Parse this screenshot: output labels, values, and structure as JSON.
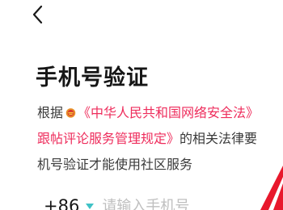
{
  "header": {
    "back_icon": "chevron-left-icon"
  },
  "title": "手机号验证",
  "notice": {
    "prefix": "根据",
    "emblem_icon": "national-emblem-icon",
    "law_link_1": "《中华人民共和国网络安全法》",
    "law_link_2": "跟帖评论服务管理规定》",
    "middle": "的相关法律要",
    "suffix": "机号验证才能使用社区服务"
  },
  "phone": {
    "country_code": "+86",
    "placeholder": "请输入手机号"
  },
  "colors": {
    "link": "#ee2d5c",
    "caret": "#3fc2c6",
    "text": "#161616",
    "placeholder": "#bfbfbf"
  }
}
